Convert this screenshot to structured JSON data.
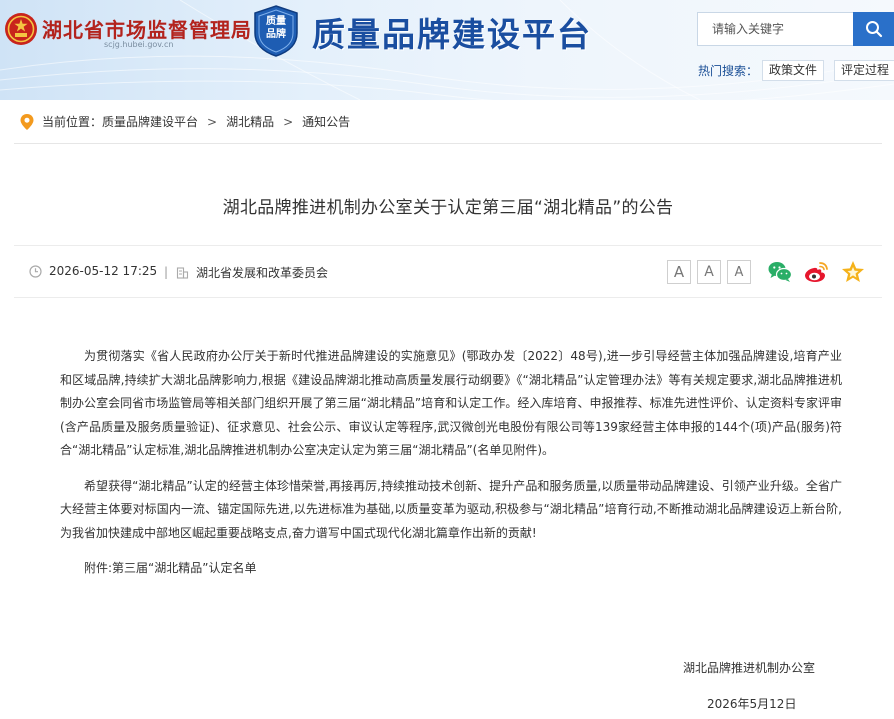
{
  "header": {
    "agency_name": "湖北省市场监督管理局",
    "agency_url": "scjg.hubei.gov.cn",
    "badge_line1": "质量",
    "badge_line2": "品牌",
    "platform_title": "质量品牌建设平台",
    "search_placeholder": "请输入关键字",
    "hot_search_label": "热门搜索：",
    "hot_tags": [
      "政策文件",
      "评定过程"
    ]
  },
  "breadcrumb": {
    "label": "当前位置：",
    "items": [
      "质量品牌建设平台",
      "湖北精品",
      "通知公告"
    ],
    "separator": ">"
  },
  "article": {
    "title": "湖北品牌推进机制办公室关于认定第三届“湖北精品”的公告",
    "datetime": "2026-05-12 17:25",
    "source": "湖北省发展和改革委员会",
    "meta_divider": "|",
    "font_size_buttons": [
      "A",
      "A",
      "A"
    ],
    "share_icons": [
      "wechat-icon",
      "weibo-icon",
      "favorite-star-icon"
    ],
    "paragraphs": [
      "为贯彻落实《省人民政府办公厅关于新时代推进品牌建设的实施意见》(鄂政办发〔2022〕48号),进一步引导经营主体加强品牌建设,培育产业和区域品牌,持续扩大湖北品牌影响力,根据《建设品牌湖北推动高质量发展行动纲要》《“湖北精品”认定管理办法》等有关规定要求,湖北品牌推进机制办公室会同省市场监管局等相关部门组织开展了第三届“湖北精品”培育和认定工作。经入库培育、申报推荐、标准先进性评价、认定资料专家评审(含产品质量及服务质量验证)、征求意见、社会公示、审议认定等程序,武汉微创光电股份有限公司等139家经营主体申报的144个(项)产品(服务)符合“湖北精品”认定标准,湖北品牌推进机制办公室决定认定为第三届“湖北精品”(名单见附件)。",
      "希望获得“湖北精品”认定的经营主体珍惜荣誉,再接再厉,持续推动技术创新、提升产品和服务质量,以质量带动品牌建设、引领产业升级。全省广大经营主体要对标国内一流、锚定国际先进,以先进标准为基础,以质量变革为驱动,积极参与“湖北精品”培育行动,不断推动湖北品牌建设迈上新台阶,为我省加快建成中部地区崛起重要战略支点,奋力谱写中国式现代化湖北篇章作出新的贡献!"
    ],
    "attachment": "附件:第三届“湖北精品”认定名单",
    "signature_org": "湖北品牌推进机制办公室",
    "signature_date": "2026年5月12日"
  },
  "colors": {
    "agency_red": "#b3231d",
    "title_blue": "#1a4ea0",
    "search_blue": "#2a70c9",
    "wechat_green": "#2aae67",
    "weibo_red": "#e6162d",
    "star_gold": "#f5b21a"
  }
}
